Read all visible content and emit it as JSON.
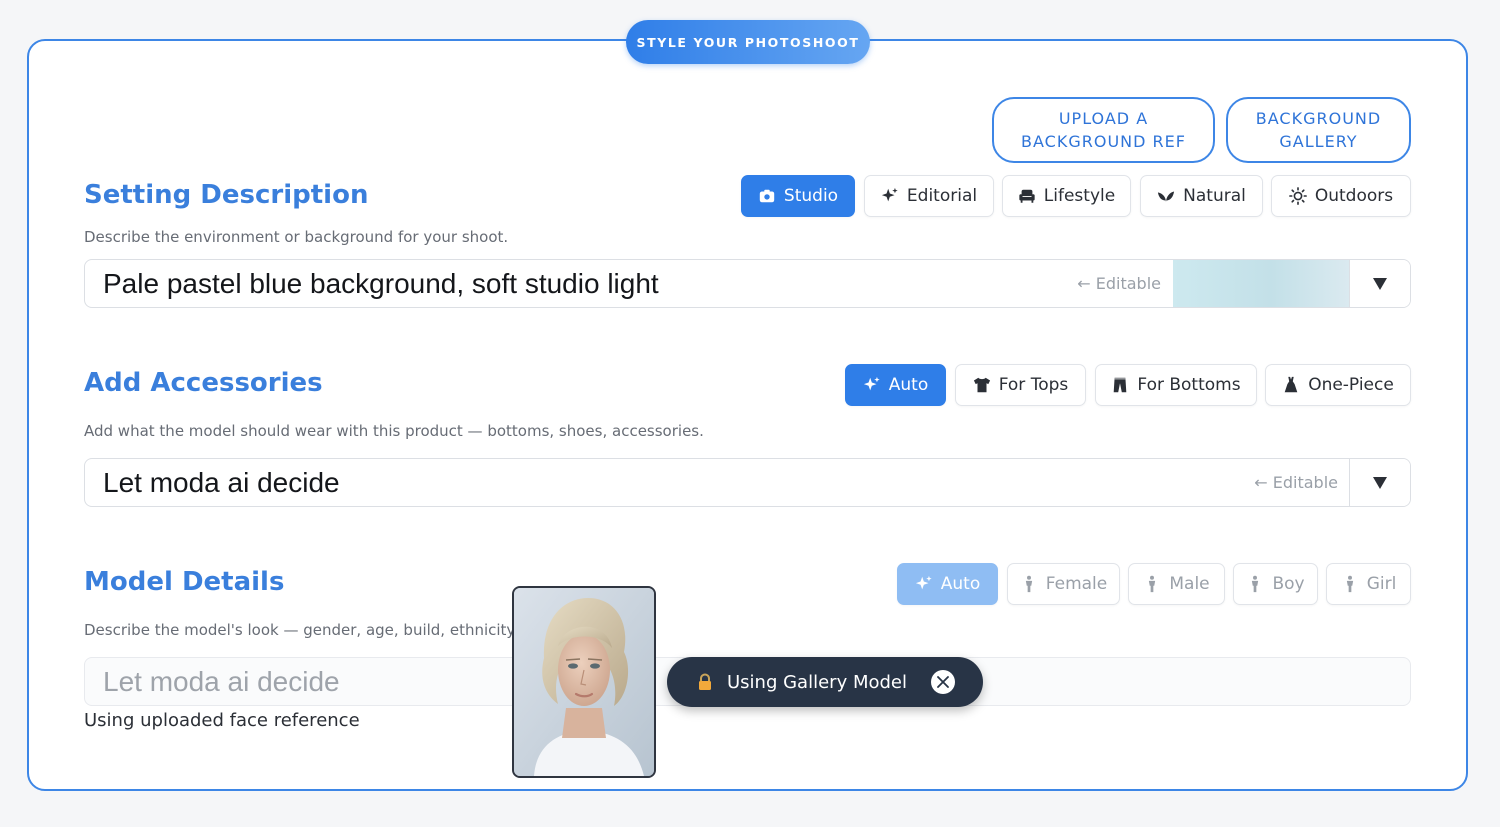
{
  "header": {
    "title": "STYLE YOUR PHOTOSHOOT"
  },
  "refs": {
    "upload_bg": "UPLOAD A\nBACKGROUND REF",
    "bg_gallery": "BACKGROUND\nGALLERY"
  },
  "setting": {
    "title": "Setting Description",
    "description": "Describe the environment or background for your shoot.",
    "value": "Pale pastel blue background, soft studio light",
    "editable_hint": "← Editable",
    "swatch_color": "#c9e5ec",
    "chips": [
      {
        "label": "Studio",
        "icon": "camera-icon",
        "active": true
      },
      {
        "label": "Editorial",
        "icon": "sparkle-icon",
        "active": false
      },
      {
        "label": "Lifestyle",
        "icon": "sofa-icon",
        "active": false
      },
      {
        "label": "Natural",
        "icon": "leaf-icon",
        "active": false
      },
      {
        "label": "Outdoors",
        "icon": "sun-icon",
        "active": false
      }
    ]
  },
  "accessories": {
    "title": "Add Accessories",
    "description": "Add what the model should wear with this product — bottoms, shoes, accessories.",
    "value": "Let moda ai decide",
    "editable_hint": "← Editable",
    "chips": [
      {
        "label": "Auto",
        "icon": "sparkle-icon",
        "active": true
      },
      {
        "label": "For Tops",
        "icon": "shirt-icon",
        "active": false
      },
      {
        "label": "For Bottoms",
        "icon": "pants-icon",
        "active": false
      },
      {
        "label": "One-Piece",
        "icon": "dress-icon",
        "active": false
      }
    ]
  },
  "model": {
    "title": "Model Details",
    "description": "Describe the model's look — gender, age, build, ethnicity, h",
    "placeholder": "Let moda ai decide",
    "face_note": "Using uploaded face reference",
    "chips": [
      {
        "label": "Auto",
        "icon": "sparkle-icon",
        "active": true
      },
      {
        "label": "Female",
        "icon": "person-icon",
        "active": false
      },
      {
        "label": "Male",
        "icon": "person-icon",
        "active": false
      },
      {
        "label": "Boy",
        "icon": "person-icon",
        "active": false
      },
      {
        "label": "Girl",
        "icon": "person-icon",
        "active": false
      }
    ]
  },
  "toast": {
    "label": "Using Gallery Model"
  },
  "colors": {
    "accent": "#2f7ee8",
    "title": "#3a7fdc",
    "toast_bg": "#283446"
  }
}
